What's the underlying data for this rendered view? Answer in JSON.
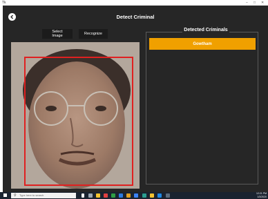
{
  "window": {
    "title": "Tk",
    "controls": [
      "–",
      "□",
      "✕"
    ]
  },
  "app": {
    "title": "Detect Criminal",
    "back_icon": "back-arrow-icon"
  },
  "toolbar": {
    "select_label": "Select Image",
    "recognize_label": "Recognize"
  },
  "image": {
    "description_icon": "face-photo",
    "detection_color": "#e02020"
  },
  "results": {
    "title": "Detected Criminals",
    "items": [
      {
        "name": "Gowtham"
      }
    ],
    "accent": "#f0a000"
  },
  "taskbar": {
    "search_placeholder": "Type here to search",
    "time": "12:21 PM",
    "date": "1/3/2020",
    "icons": [
      "start-icon",
      "task-view-icon",
      "edge-icon",
      "file-explorer-icon",
      "store-icon",
      "chrome-icon",
      "mail-icon",
      "settings-icon",
      "photos-icon",
      "terminal-icon",
      "python-icon",
      "vscode-icon",
      "more-icon"
    ]
  }
}
